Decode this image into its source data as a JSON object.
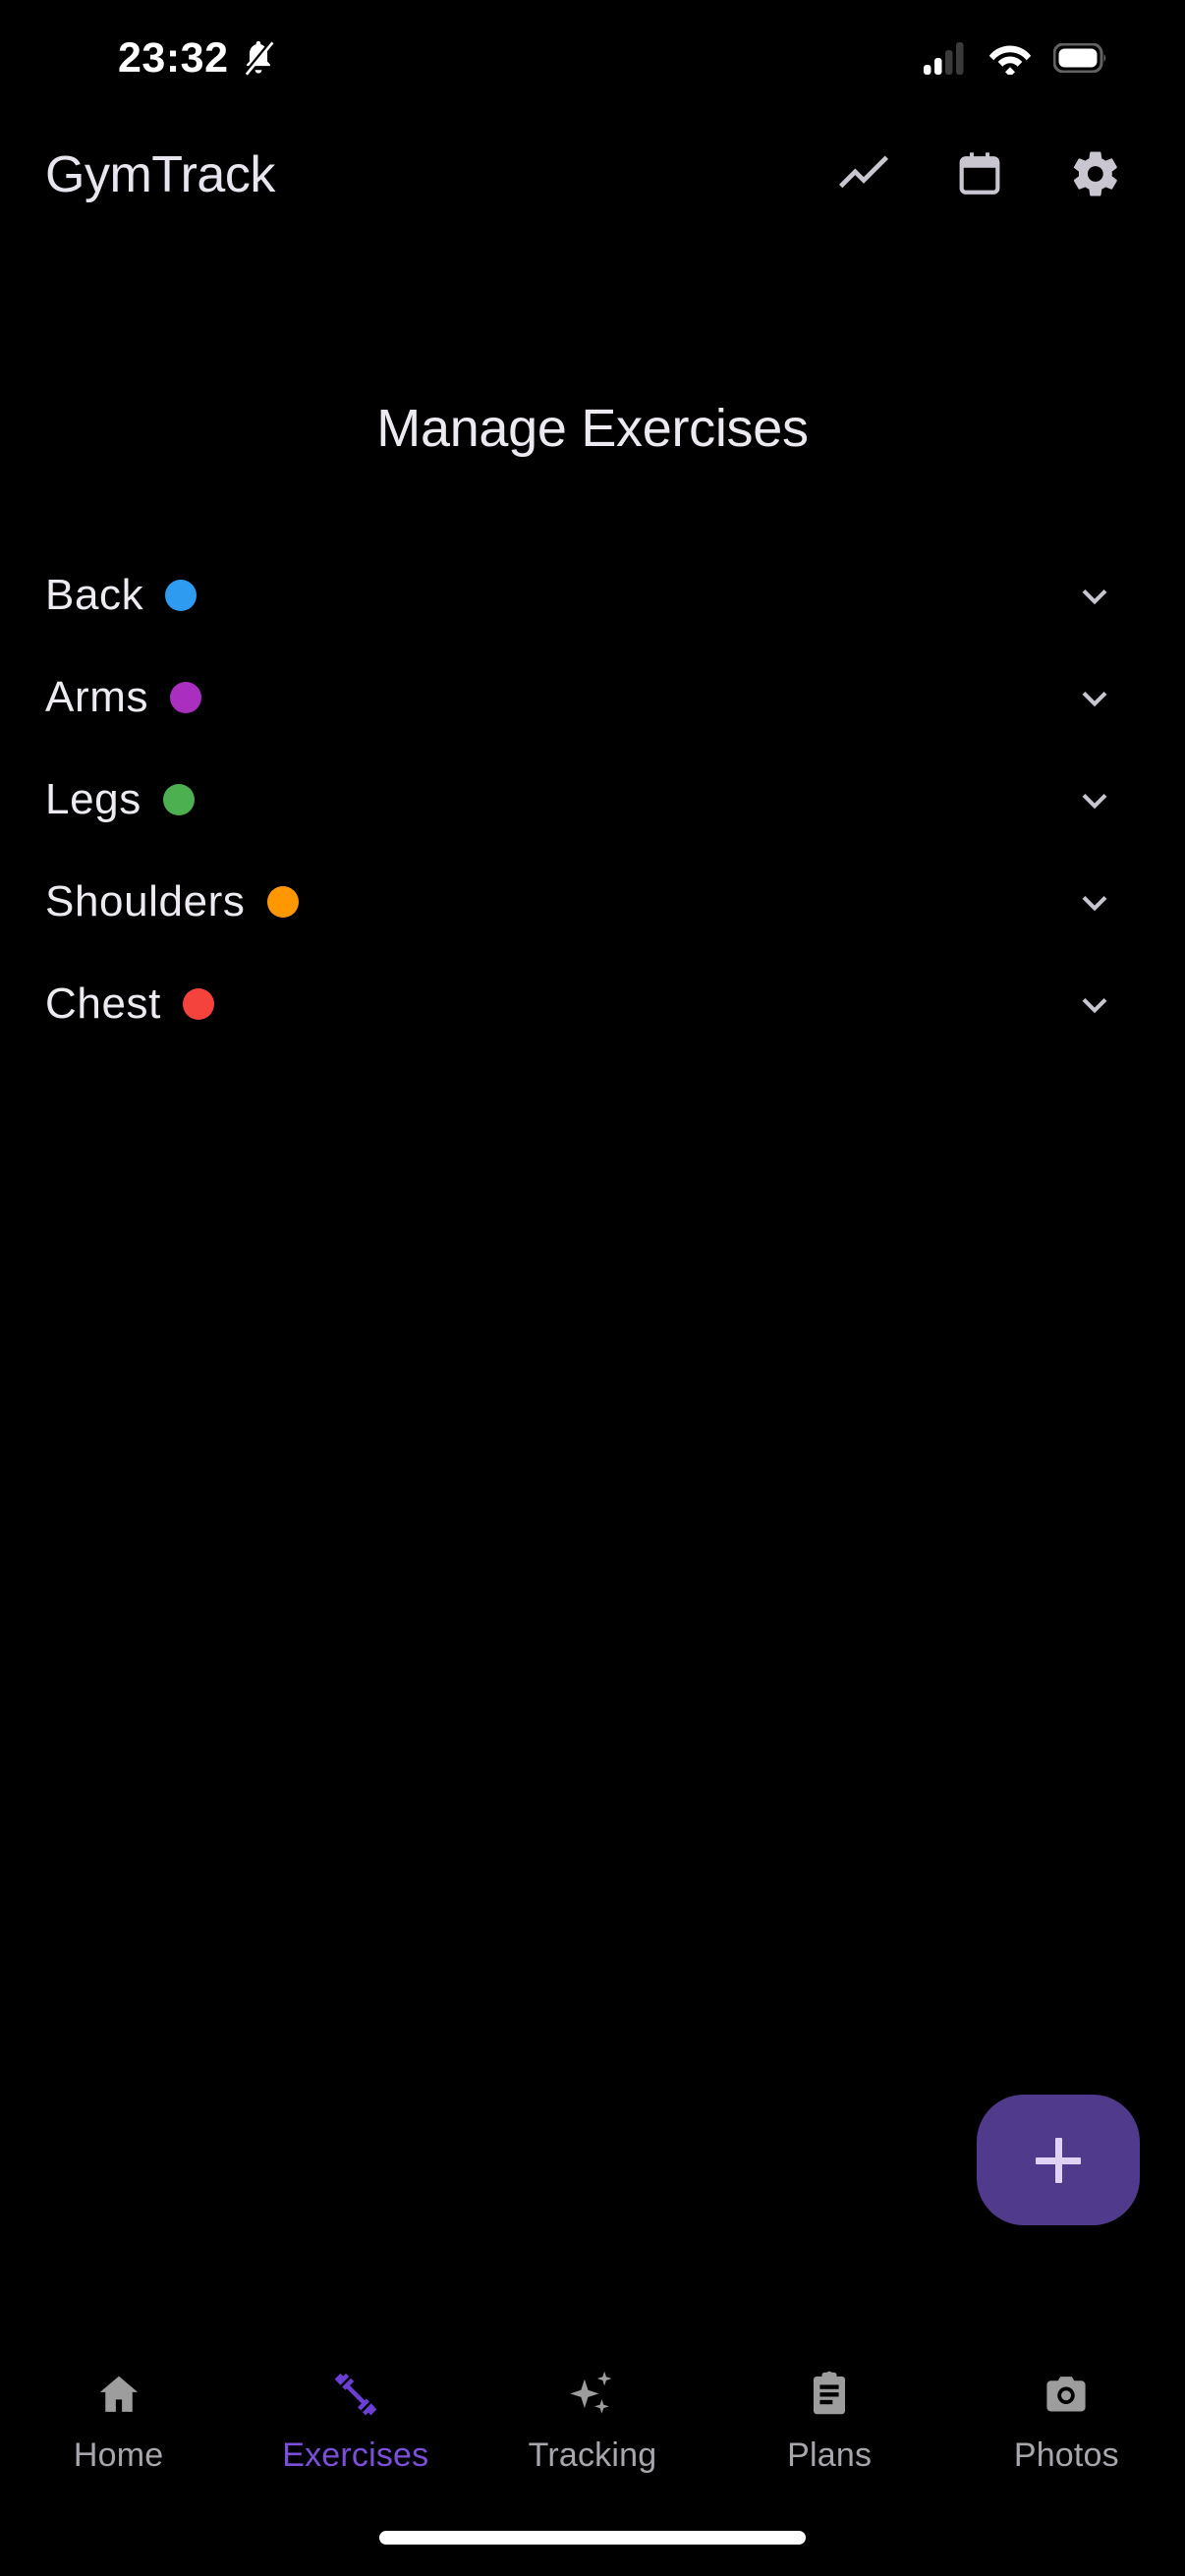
{
  "status_bar": {
    "time": "23:32",
    "icons": {
      "notifications": "bell-muted-icon",
      "signal": "signal-bars-icon",
      "wifi": "wifi-icon",
      "battery": "battery-icon"
    }
  },
  "header": {
    "app_title": "GymTrack",
    "actions": [
      {
        "name": "stats-icon",
        "label": "Stats"
      },
      {
        "name": "calendar-icon",
        "label": "Calendar"
      },
      {
        "name": "settings-gear-icon",
        "label": "Settings"
      }
    ]
  },
  "main": {
    "page_title": "Manage Exercises",
    "categories": [
      {
        "label": "Back",
        "color": "#2E9BF0",
        "expanded": false,
        "chevron": "chevron-down-icon"
      },
      {
        "label": "Arms",
        "color": "#AA2EC0",
        "expanded": false,
        "chevron": "chevron-down-icon"
      },
      {
        "label": "Legs",
        "color": "#4CAF50",
        "expanded": false,
        "chevron": "chevron-down-icon"
      },
      {
        "label": "Shoulders",
        "color": "#FF9800",
        "expanded": false,
        "chevron": "chevron-down-icon"
      },
      {
        "label": "Chest",
        "color": "#F4433C",
        "expanded": false,
        "chevron": "chevron-down-icon"
      }
    ]
  },
  "fab": {
    "label": "+",
    "icon": "plus-icon",
    "background": "#4F3A8C",
    "foreground": "#DED2F5"
  },
  "bottom_nav": {
    "active_index": 1,
    "active_color": "#7B4FD8",
    "inactive_color": "#A8A5AD",
    "items": [
      {
        "label": "Home",
        "icon": "home-icon"
      },
      {
        "label": "Exercises",
        "icon": "dumbbell-icon"
      },
      {
        "label": "Tracking",
        "icon": "sparkles-icon"
      },
      {
        "label": "Plans",
        "icon": "clipboard-icon"
      },
      {
        "label": "Photos",
        "icon": "camera-icon"
      }
    ]
  },
  "system": {
    "home_indicator": "home-indicator-bar"
  }
}
